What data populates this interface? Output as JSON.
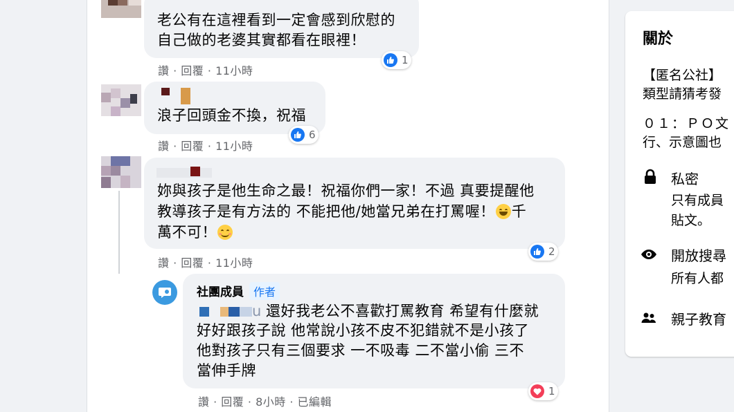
{
  "comments": [
    {
      "text_lines": [
        "老公有在這裡看到一定會感到欣慰的",
        "自己做的老婆其實都看在眼裡！"
      ],
      "actions": {
        "like": "讚",
        "reply": "回覆",
        "time": "11小時"
      },
      "reactions": {
        "type": "like-icon",
        "count": "1"
      }
    },
    {
      "text_lines": [
        "浪子回頭金不換，祝福"
      ],
      "actions": {
        "like": "讚",
        "reply": "回覆",
        "time": "11小時"
      },
      "reactions": {
        "type": "like-icon",
        "count": "6"
      }
    },
    {
      "text_lines": [
        "妳與孩子是他生命之最！祝福你們一家！不過 真要提醒他",
        "教導孩子是有方法的 不能把他/她當兄弟在打罵喔！",
        "千",
        "萬不可！"
      ],
      "actions": {
        "like": "讚",
        "reply": "回覆",
        "time": "11小時"
      },
      "reactions": {
        "type": "like-icon",
        "count": "2"
      }
    }
  ],
  "reply": {
    "author": "社團成員",
    "badge": "作者",
    "mention_tail": "u",
    "text_lines": [
      "還好我老公不喜歡打罵教育 希望有什麼就",
      "好好跟孩子說 他常說小孩不皮不犯錯就不是小孩了",
      "他對孩子只有三個要求 一不吸毒 二不當小偷 三不",
      "當伸手牌"
    ],
    "actions": {
      "like": "讚",
      "reply": "回覆",
      "time": "8小時",
      "edited": "已編輯"
    },
    "reactions": {
      "type": "heart-icon",
      "count": "1"
    }
  },
  "about": {
    "title": "關於",
    "desc_line1": "【匿名公社】",
    "desc_line2": "類型請猜考發",
    "rule_line1": "０１：ＰＯ文",
    "rule_line2": "行、示意圖也",
    "privacy_title": "私密",
    "privacy_line1": "只有成員",
    "privacy_line2": "貼文。",
    "visible_title": "開放搜尋",
    "visible_line1": "所有人都",
    "topic_title": "親子教育"
  },
  "colors": {
    "accent": "#1877f2",
    "heart": "#f33e58",
    "bubble": "#f0f2f5",
    "muted": "#65676b"
  }
}
